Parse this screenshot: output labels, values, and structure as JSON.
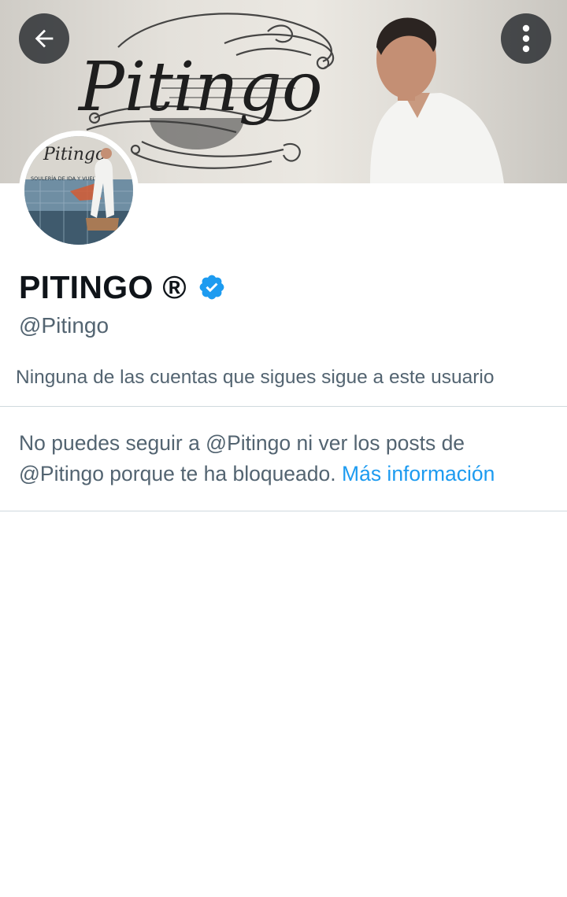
{
  "header": {
    "back_icon": "arrow-left-icon",
    "more_icon": "more-vertical-icon",
    "banner_logo_text": "Pitingo"
  },
  "profile": {
    "display_name": "PITINGO ®",
    "verified_icon": "verified-badge-icon",
    "handle": "@Pitingo",
    "follow_note": "Ninguna de las cuentas que sigues sigue a este usuario",
    "avatar_album_title": "Pitingo",
    "avatar_album_subtitle": "SOULERÍA DE IDA Y VUELTA"
  },
  "blocked": {
    "message": "No puedes seguir a @Pitingo ni ver los posts de @Pitingo porque te ha bloqueado.",
    "link_label": "Más información"
  },
  "colors": {
    "text_primary": "#0f1419",
    "text_secondary": "#536471",
    "accent": "#1d9bf0",
    "divider": "#cfd9de"
  }
}
